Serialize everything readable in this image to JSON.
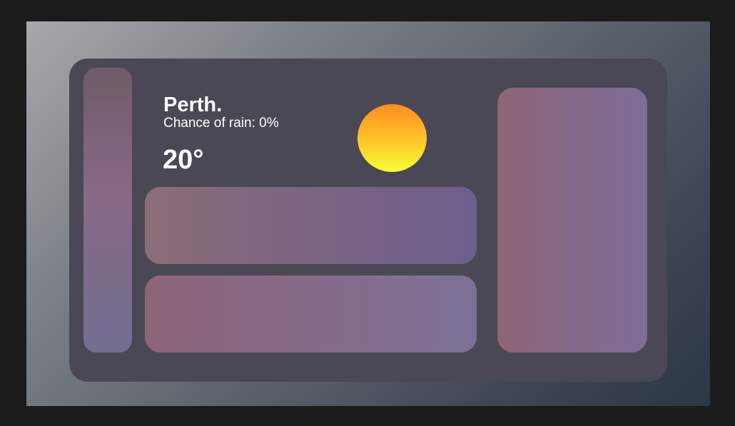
{
  "weather": {
    "city": "Perth.",
    "rain_label": "Chance of rain: 0%",
    "temperature": "20°",
    "condition_icon": "sun-icon"
  },
  "colors": {
    "app_panel": "#4a4854",
    "sun_top": "#ff8c1f",
    "sun_bottom": "#f4ff33",
    "text": "#ffffff"
  }
}
